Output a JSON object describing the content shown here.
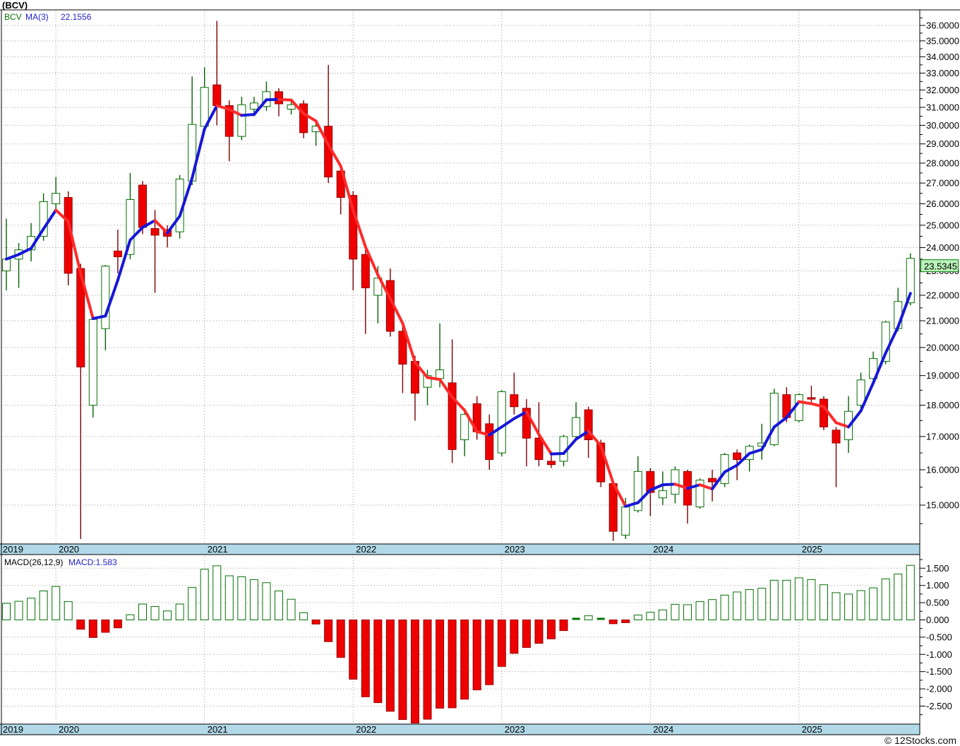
{
  "window": {
    "title": "(BCV)"
  },
  "legend": {
    "symbol": "BCV",
    "ma_label": "MA(3)",
    "ma_value": "22.1556"
  },
  "macd_legend": {
    "label": "MACD(26,12,9)",
    "value_label": "MACD:1.583"
  },
  "price_box": {
    "value": "23.5345"
  },
  "copyright": "© 12Stocks.com",
  "colors": {
    "up": "#067006",
    "up_wick": "#056005",
    "down": "#ee0000",
    "down_border": "#990000",
    "down_wick": "#7b0000",
    "ma_up": "#1717d8",
    "ma_down": "#ff2a2a",
    "band": "#b2d9e8",
    "grid": "#9a9a9a",
    "price_box_bg": "#b9f2b9",
    "price_box_border": "#0a7a0a"
  },
  "chart_data": [
    {
      "type": "candlestick",
      "title": "(BCV)",
      "ylabel": "price",
      "y_scale": "log",
      "ylim": [
        14.9,
        37.0
      ],
      "y_tick_step": 1.0,
      "y_minor_tick_step": 0.5,
      "y_tick_format": "0.0000",
      "grid": true,
      "x_year_labels": [
        "2019",
        "2020",
        "2021",
        "2022",
        "2023",
        "2024",
        "2025"
      ],
      "last_price": 23.5345,
      "ma": {
        "window": 3,
        "value": 22.1556,
        "note": "blue when rising, red when falling"
      },
      "months": [
        "2019-09",
        "2019-10",
        "2019-11",
        "2019-12",
        "2020-01",
        "2020-02",
        "2020-03",
        "2020-04",
        "2020-05",
        "2020-06",
        "2020-07",
        "2020-08",
        "2020-09",
        "2020-10",
        "2020-11",
        "2020-12",
        "2021-01",
        "2021-02",
        "2021-03",
        "2021-04",
        "2021-05",
        "2021-06",
        "2021-07",
        "2021-08",
        "2021-09",
        "2021-10",
        "2021-11",
        "2021-12",
        "2022-01",
        "2022-02",
        "2022-03",
        "2022-04",
        "2022-05",
        "2022-06",
        "2022-07",
        "2022-08",
        "2022-09",
        "2022-10",
        "2022-11",
        "2022-12",
        "2023-01",
        "2023-02",
        "2023-03",
        "2023-04",
        "2023-05",
        "2023-06",
        "2023-07",
        "2023-08",
        "2023-09",
        "2023-10",
        "2023-11",
        "2023-12",
        "2024-01",
        "2024-02",
        "2024-03",
        "2024-04",
        "2024-05",
        "2024-06",
        "2024-07",
        "2024-08",
        "2024-09",
        "2024-10",
        "2024-11",
        "2024-12",
        "2025-01",
        "2025-02",
        "2025-03",
        "2025-04",
        "2025-05",
        "2025-06",
        "2025-07",
        "2025-08",
        "2025-09",
        "2025-10"
      ],
      "ohlc": [
        [
          23.0,
          25.3,
          22.2,
          23.5
        ],
        [
          23.5,
          24.2,
          22.3,
          23.9
        ],
        [
          23.9,
          25.1,
          23.4,
          24.5
        ],
        [
          24.5,
          26.5,
          24.3,
          26.1
        ],
        [
          26.0,
          27.3,
          25.7,
          26.5
        ],
        [
          26.3,
          26.6,
          22.4,
          22.9
        ],
        [
          23.1,
          23.3,
          14.1,
          19.3
        ],
        [
          18.0,
          21.1,
          17.6,
          21.05
        ],
        [
          20.7,
          23.25,
          19.9,
          23.2
        ],
        [
          23.85,
          24.8,
          22.9,
          23.6
        ],
        [
          23.7,
          27.5,
          23.5,
          26.2
        ],
        [
          26.9,
          27.1,
          24.6,
          24.9
        ],
        [
          24.85,
          25.7,
          22.1,
          24.55
        ],
        [
          24.8,
          25.0,
          24.0,
          24.5
        ],
        [
          24.7,
          27.4,
          24.4,
          27.2
        ],
        [
          27.1,
          32.8,
          26.9,
          30.05
        ],
        [
          29.95,
          33.35,
          29.7,
          32.15
        ],
        [
          32.3,
          36.3,
          30.0,
          31.1
        ],
        [
          31.1,
          31.4,
          28.1,
          29.4
        ],
        [
          29.4,
          31.6,
          29.2,
          31.15
        ],
        [
          30.9,
          31.6,
          30.5,
          31.25
        ],
        [
          31.05,
          32.5,
          30.8,
          31.9
        ],
        [
          31.9,
          32.1,
          30.5,
          31.2
        ],
        [
          30.9,
          31.5,
          30.6,
          31.15
        ],
        [
          31.2,
          31.4,
          29.3,
          29.6
        ],
        [
          29.65,
          30.1,
          28.9,
          29.95
        ],
        [
          29.95,
          33.5,
          27.0,
          27.3
        ],
        [
          27.6,
          27.8,
          25.5,
          26.3
        ],
        [
          26.4,
          26.6,
          22.2,
          23.5
        ],
        [
          23.7,
          23.9,
          20.5,
          22.3
        ],
        [
          22.0,
          23.2,
          20.9,
          22.7
        ],
        [
          22.6,
          23.1,
          20.4,
          20.6
        ],
        [
          20.6,
          20.8,
          18.4,
          19.4
        ],
        [
          19.5,
          19.7,
          17.5,
          18.4
        ],
        [
          18.6,
          19.2,
          18.0,
          19.0
        ],
        [
          18.9,
          20.9,
          18.6,
          19.2
        ],
        [
          18.75,
          20.3,
          16.2,
          16.6
        ],
        [
          16.9,
          17.9,
          16.4,
          17.7
        ],
        [
          18.05,
          18.3,
          16.9,
          17.15
        ],
        [
          17.4,
          17.7,
          16.0,
          16.3
        ],
        [
          16.5,
          18.5,
          16.4,
          18.45
        ],
        [
          18.35,
          19.1,
          17.7,
          17.95
        ],
        [
          17.9,
          18.2,
          16.1,
          16.95
        ],
        [
          16.95,
          18.1,
          16.1,
          16.3
        ],
        [
          16.25,
          16.55,
          16.05,
          16.15
        ],
        [
          16.25,
          17.05,
          16.1,
          17.0
        ],
        [
          17.0,
          18.1,
          16.9,
          17.6
        ],
        [
          17.85,
          17.95,
          16.35,
          16.9
        ],
        [
          16.8,
          16.9,
          15.5,
          15.65
        ],
        [
          15.6,
          15.7,
          14.05,
          14.3
        ],
        [
          14.2,
          15.2,
          14.1,
          14.95
        ],
        [
          14.85,
          16.4,
          14.8,
          15.95
        ],
        [
          15.95,
          16.05,
          14.7,
          15.35
        ],
        [
          15.2,
          15.95,
          15.0,
          15.4
        ],
        [
          15.3,
          16.1,
          15.05,
          16.0
        ],
        [
          15.95,
          16.0,
          14.5,
          15.0
        ],
        [
          14.95,
          15.75,
          14.9,
          15.7
        ],
        [
          15.75,
          16.0,
          15.1,
          15.65
        ],
        [
          15.6,
          16.5,
          15.5,
          16.45
        ],
        [
          16.5,
          16.6,
          15.7,
          16.3
        ],
        [
          16.3,
          16.75,
          15.95,
          16.7
        ],
        [
          16.7,
          17.4,
          16.3,
          16.8
        ],
        [
          16.75,
          18.55,
          16.7,
          18.4
        ],
        [
          18.35,
          18.6,
          17.45,
          17.6
        ],
        [
          17.5,
          18.4,
          17.45,
          18.35
        ],
        [
          18.25,
          18.65,
          18.1,
          18.2
        ],
        [
          18.2,
          18.3,
          17.2,
          17.3
        ],
        [
          17.2,
          17.3,
          15.5,
          16.8
        ],
        [
          16.9,
          18.3,
          16.5,
          17.8
        ],
        [
          18.0,
          19.1,
          17.9,
          18.85
        ],
        [
          18.9,
          19.85,
          18.8,
          19.6
        ],
        [
          19.5,
          21.0,
          19.4,
          20.95
        ],
        [
          20.7,
          22.3,
          20.6,
          21.75
        ],
        [
          21.7,
          23.75,
          21.6,
          23.5345
        ]
      ]
    },
    {
      "type": "bar",
      "title": "MACD(26,12,9)",
      "last_value": 1.583,
      "ylim": [
        -3.05,
        1.8
      ],
      "y_ticks": [
        1.5,
        1.0,
        0.5,
        0.0,
        -0.5,
        -1.0,
        -1.5,
        -2.0,
        -2.5
      ],
      "y_tick_format": "0.000",
      "grid": true,
      "values": [
        0.48,
        0.54,
        0.63,
        0.84,
        0.97,
        0.53,
        -0.27,
        -0.51,
        -0.36,
        -0.23,
        0.15,
        0.46,
        0.39,
        0.26,
        0.46,
        0.94,
        1.47,
        1.57,
        1.28,
        1.25,
        1.17,
        1.08,
        0.84,
        0.6,
        0.21,
        -0.12,
        -0.63,
        -1.09,
        -1.72,
        -2.23,
        -2.4,
        -2.65,
        -2.89,
        -3.05,
        -2.88,
        -2.56,
        -2.55,
        -2.3,
        -2.03,
        -1.88,
        -1.35,
        -0.97,
        -0.8,
        -0.68,
        -0.55,
        -0.31,
        0.02,
        0.12,
        0.07,
        -0.11,
        -0.08,
        0.14,
        0.22,
        0.29,
        0.45,
        0.44,
        0.53,
        0.59,
        0.72,
        0.81,
        0.88,
        0.92,
        1.15,
        1.15,
        1.22,
        1.17,
        1.02,
        0.79,
        0.75,
        0.85,
        0.93,
        1.19,
        1.33,
        1.583
      ]
    }
  ]
}
